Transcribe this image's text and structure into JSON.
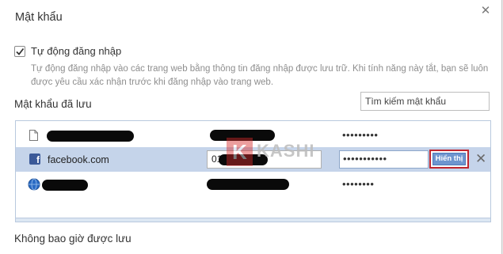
{
  "dialog": {
    "title": "Mật khẩu",
    "close_label": "✕"
  },
  "autologin": {
    "label": "Tự động đăng nhập",
    "checked": true,
    "description": "Tự động đăng nhập vào các trang web bằng thông tin đăng nhập được lưu trữ. Khi tính năng này tắt, bạn sẽ luôn được yêu cầu xác nhận trước khi đăng nhập vào trang web."
  },
  "saved": {
    "title": "Mật khẩu đã lưu",
    "search_placeholder": "Tìm kiếm mật khẩu",
    "rows": [
      {
        "icon": "document-icon",
        "site": "",
        "username": "",
        "password": "•••••••••"
      },
      {
        "icon": "facebook-icon",
        "site": "facebook.com",
        "username": "01",
        "password": "•••••••••••",
        "show_label": "Hiển thị",
        "remove_label": "✕"
      },
      {
        "icon": "globe-icon",
        "site": "",
        "username": "",
        "password": "••••••••"
      }
    ]
  },
  "never_saved": {
    "title": "Không bao giờ được lưu"
  },
  "watermark": {
    "logo_letter": "K",
    "text": "KASHI"
  },
  "colors": {
    "selected_row": "#c5d4ea",
    "show_button": "#6e95cf",
    "highlight_border": "#c0262f",
    "facebook": "#3b5998"
  }
}
